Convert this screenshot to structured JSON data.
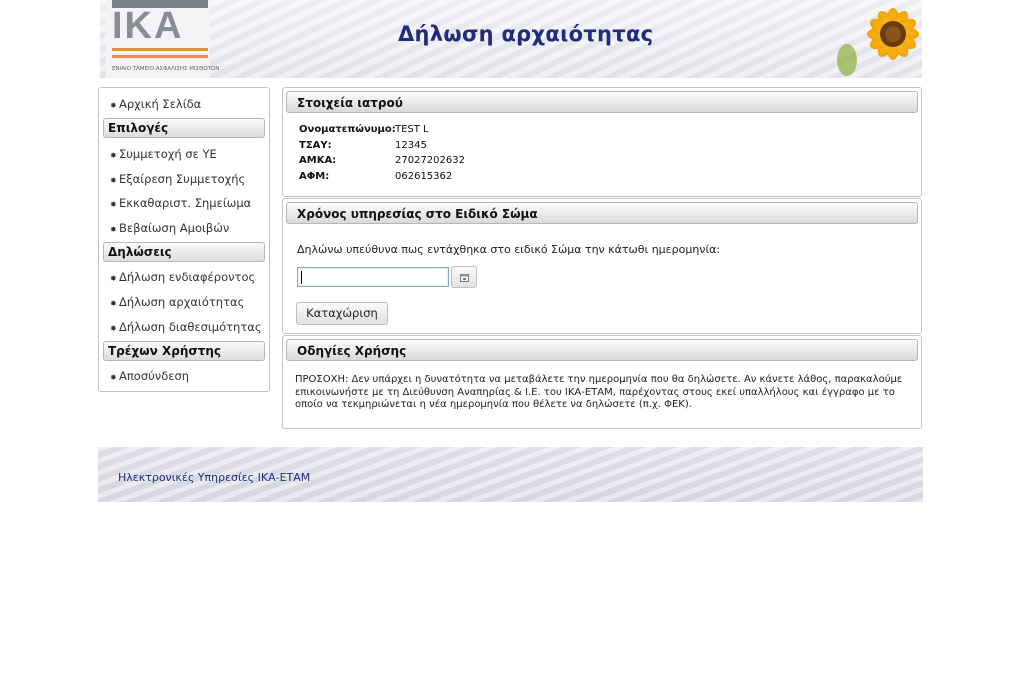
{
  "header": {
    "logo_text": "IKA",
    "logo_subtitle": "ΕΝΙΑΙΟ ΤΑΜΕΙΟ ΑΣΦΑΛΙΣΗΣ ΜΙΣΘΩΤΩΝ",
    "page_title": "Δήλωση αρχαιότητας"
  },
  "sidebar": {
    "home": "Αρχική Σελίδα",
    "sections": [
      {
        "title": "Επιλογές",
        "items": [
          "Συμμετοχή σε ΥΕ",
          "Εξαίρεση Συμμετοχής",
          "Εκκαθαριστ. Σημείωμα",
          "Βεβαίωση Αμοιβών"
        ]
      },
      {
        "title": "Δηλώσεις",
        "items": [
          "Δήλωση ενδιαφέροντος",
          "Δήλωση αρχαιότητας",
          "Δήλωση διαθεσιμότητας"
        ]
      },
      {
        "title": "Τρέχων Χρήστης",
        "items": [
          "Αποσύνδεση"
        ]
      }
    ]
  },
  "doctor_panel": {
    "title": "Στοιχεία ιατρού",
    "fields": [
      {
        "label": "Ονοματεπώνυμο:",
        "value": "TEST L"
      },
      {
        "label": "ΤΣΑΥ:",
        "value": "12345"
      },
      {
        "label": "ΑΜΚΑ:",
        "value": "27027202632"
      },
      {
        "label": "ΑΦΜ:",
        "value": "062615362"
      }
    ]
  },
  "service_panel": {
    "title": "Χρόνος υπηρεσίας στο Ειδικό Σώμα",
    "statement": "Δηλώνω υπεύθυνα πως εντάχθηκα στο ειδικό Σώμα την κάτωθι ημερομηνία:",
    "date_value": "",
    "submit_label": "Καταχώριση",
    "calendar_icon": "calendar-icon"
  },
  "instructions_panel": {
    "title": "Οδηγίες Χρήσης",
    "text": "ΠΡΟΣΟΧΗ: Δεν υπάρχει η δυνατότητα να μεταβάλετε την ημερομηνία που θα δηλώσετε. Αν κάνετε λάθος, παρακαλούμε επικοινωνήστε με τη Διεύθυνση Αναπηρίας & Ι.Ε. του ΙΚΑ-ΕΤΑΜ, παρέχοντας στους εκεί υπαλλήλους και έγγραφο με το οποίο να τεκμηριώνεται η νέα ημερομηνία που θέλετε να δηλώσετε (π.χ. ΦΕΚ)."
  },
  "footer": {
    "text": "Ηλεκτρονικές Υπηρεσίες ΙΚΑ-ΕΤΑΜ"
  },
  "colors": {
    "title_blue": "#1e2c7a",
    "logo_orange": "#e48f3a",
    "logo_grey": "#8a8d95"
  }
}
